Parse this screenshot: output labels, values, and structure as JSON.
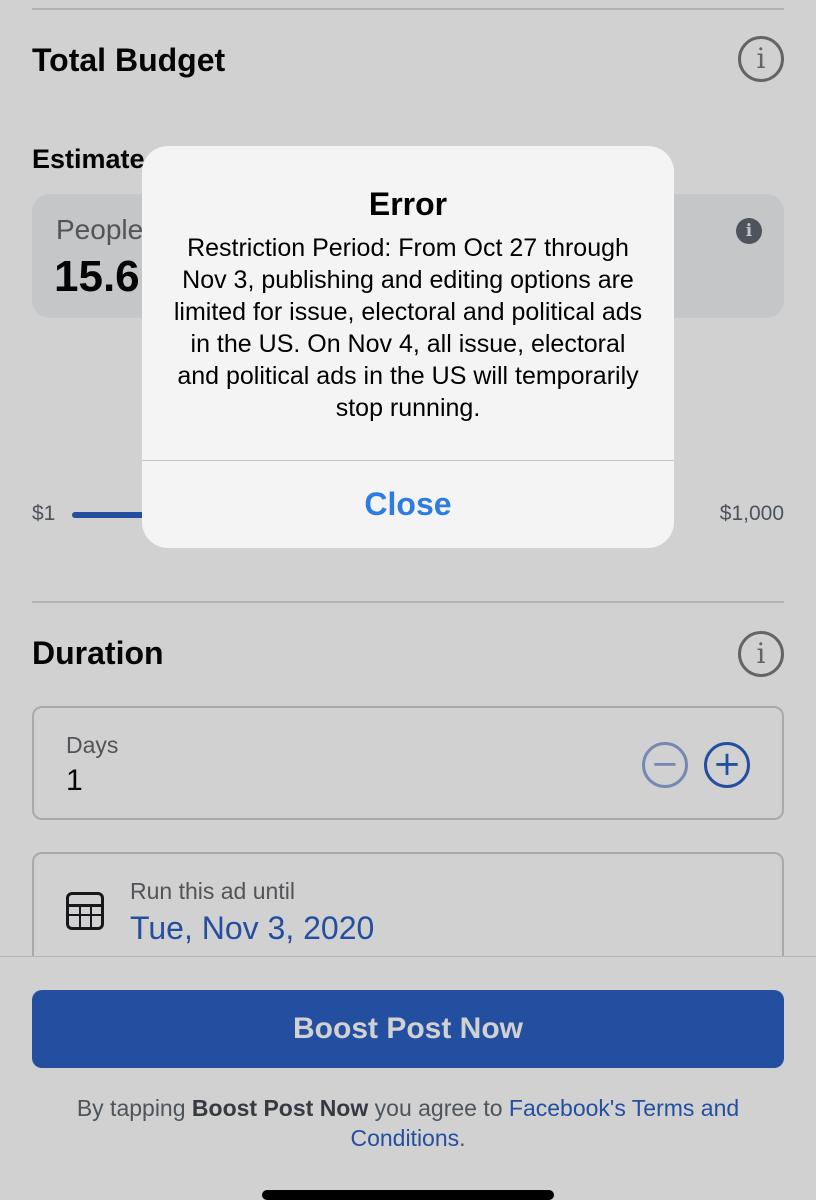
{
  "budget": {
    "title": "Total Budget",
    "info_icon": "info-circle-icon",
    "estimated_heading": "Estimate",
    "estimate_label": "People",
    "estimate_value": "15.6",
    "slider_min": "$1",
    "slider_max": "$1,000"
  },
  "duration": {
    "title": "Duration",
    "info_icon": "info-circle-icon",
    "days_label": "Days",
    "days_value": "1",
    "minus_icon": "minus-circle-icon",
    "plus_icon": "plus-circle-icon",
    "run_until_label": "Run this ad until",
    "run_until_date": "Tue, Nov 3, 2020",
    "calendar_icon": "calendar-icon"
  },
  "footer": {
    "boost_button": "Boost Post Now",
    "terms_prefix": "By tapping ",
    "terms_bold": "Boost Post Now",
    "terms_middle": " you agree to ",
    "terms_link": "Facebook's Terms and Conditions",
    "terms_suffix": "."
  },
  "alert": {
    "title": "Error",
    "message": "Restriction Period: From Oct 27 through Nov 3, publishing and editing options are limited for issue, electoral and political ads in the US. On Nov 4, all issue, electoral and political ads in the US will temporarily stop running.",
    "close_button": "Close"
  },
  "colors": {
    "accent": "#2d61c4",
    "alert_action": "#2d7ce4"
  }
}
